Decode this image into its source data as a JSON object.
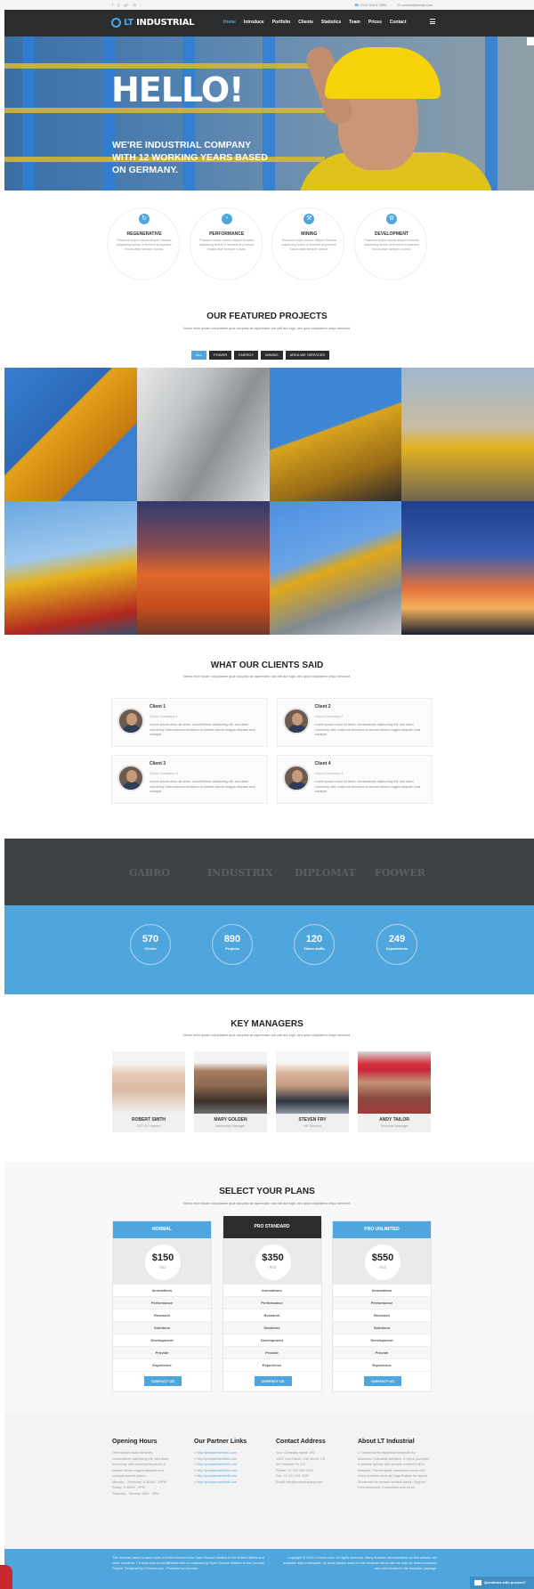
{
  "topbar": {
    "social": [
      "f",
      "y",
      "g+",
      "in"
    ],
    "phone": "+012 345 6 7890",
    "email": "contact@email.com"
  },
  "navbar": {
    "brand_prefix": "LT",
    "brand": "INDUSTRIAL",
    "menu": [
      "Home",
      "Introduce",
      "Portfolio",
      "Clients",
      "Statistics",
      "Team",
      "Prices",
      "Contact"
    ],
    "active_index": 0
  },
  "hero": {
    "title": "HELLO!",
    "subtitle": "WE'RE INDUSTRIAL COMPANY WITH 12 WORKING YEARS BASED ON GERMANY."
  },
  "features": [
    {
      "title": "REGENERATIVE",
      "text": "Praesent turpis mauris aliquet Gravida adipiscing lectus ut ferment at posuere fuscia vitae semper conval.",
      "icon": "refresh-icon"
    },
    {
      "title": "PERFORMANCE",
      "text": "Praesent turpis mauris aliquet Gravida adipiscing lectus ut ferment at posuere fuscia vitae semper conval.",
      "icon": "gauge-icon"
    },
    {
      "title": "MINING",
      "text": "Praesent turpis mauris aliquet Gravida adipiscing lectus ut ferment at posuere fuscia vitae semper conval.",
      "icon": "pickaxe-icon"
    },
    {
      "title": "DEVELOPMENT",
      "text": "Praesent turpis mauris aliquet Gravida adipiscing lectus ut ferment at posuere fuscia vitae semper conval.",
      "icon": "gear-icon"
    }
  ],
  "projects": {
    "title": "OUR FEATURED PROJECTS",
    "subtitle": "Nemo enim ipsam voluptatem quia voluptas sit aspernatur aut odit aut fugit, sed quia voluptatem sequi nesciunt.",
    "filters": [
      "ALL",
      "POWER",
      "ENERGY",
      "MINING",
      "AREA WE SERVICES"
    ],
    "active_filter": 0
  },
  "clients": {
    "title": "WHAT OUR CLIENTS SAID",
    "subtitle": "Nemo enim ipsam voluptatem quia voluptas sit aspernatur aut odit aut fugit, sed quia voluptatem sequi nesciunt.",
    "items": [
      {
        "name": "Client 1",
        "company": "Client Company 1",
        "quote": "Lorem ipsum dolor sit amet, consectetuer adipiscing elit, sed diam nonummy nibh euismod tincidunt ut laoreet dolore magna aliquam erat volutpat."
      },
      {
        "name": "Client 2",
        "company": "Client Company 2",
        "quote": "Lorem ipsum dolor sit amet, consectetuer adipiscing elit, sed diam nonummy nibh euismod tincidunt ut laoreet dolore magna aliquam erat volutpat."
      },
      {
        "name": "Client 3",
        "company": "Client Company 3",
        "quote": "Lorem ipsum dolor sit amet, consectetuer adipiscing elit, sed diam nonummy nibh euismod tincidunt ut laoreet dolore magna aliquam erat volutpat."
      },
      {
        "name": "Client 4",
        "company": "Client Company 4",
        "quote": "Lorem ipsum dolor sit amet, consectetuer adipiscing elit, sed diam nonummy nibh euismod tincidunt ut laoreet dolore magna aliquam erat volutpat."
      }
    ]
  },
  "partners": [
    "GABRO",
    "INDUSTRIX",
    "DIPLOMAT",
    "FOOWER"
  ],
  "stats": [
    {
      "value": "570",
      "label": "Clients"
    },
    {
      "value": "890",
      "label": "Projects"
    },
    {
      "value": "120",
      "label": "Talent staffs"
    },
    {
      "value": "249",
      "label": "Departments"
    }
  ],
  "managers": {
    "title": "KEY MANAGERS",
    "subtitle": "Nemo enim ipsam voluptatem quia voluptas sit aspernatur aut odit aut fugit, sed quia voluptatem sequi nesciunt.",
    "items": [
      {
        "name": "ROBERT SMITH",
        "role": "CEO & Founder"
      },
      {
        "name": "MARY GOLDEN",
        "role": "Marketing Manager"
      },
      {
        "name": "STEVEN FRY",
        "role": "HR Director"
      },
      {
        "name": "ANDY TAILOR",
        "role": "Technical Manager"
      }
    ]
  },
  "plans": {
    "title": "SELECT YOUR PLANS",
    "subtitle": "Nemo enim ipsam voluptatem quia voluptas sit aspernatur aut odit aut fugit, sed quia voluptatem sequi nesciunt.",
    "features": [
      "Innovations",
      "Performance",
      "Research",
      "Solutions",
      "Development",
      "Provide",
      "Experience"
    ],
    "items": [
      {
        "name": "NORMAL",
        "price": "$150",
        "unit": "/m2",
        "button": "CONTACT US"
      },
      {
        "name": "PRO STANDARD",
        "price": "$350",
        "unit": "/m2",
        "button": "CONTACT US"
      },
      {
        "name": "PRO UNLIMITED",
        "price": "$550",
        "unit": "/m2",
        "button": "CONTACT US"
      }
    ]
  },
  "footer": {
    "hours": {
      "title": "Opening Hours",
      "lines": [
        "Orem ipsum dolor sit amet,",
        "consectetuer adipiscing elit, sed diam",
        "nonummy nibh euismod tincidunt ut",
        "laoreet dolore magna aliquam erat",
        "volutpat laoreet dolore.",
        "Monday - Thursday: 8.30AM - 10PM",
        "Friday: 8.30AM - 9PM",
        "Saturday - Sunday: 8AM - 4PM"
      ]
    },
    "links": {
      "title": "Our Partner Links",
      "items": [
        "> http://yourpartnerlink1.com",
        "> http://yourpartnerlink2.com",
        "> http://yourpartnerlink3.com",
        "> http://yourpartnerlink4.com",
        "> http://yourpartnerlink5.com",
        "> http://yourpartnerlink6.com"
      ]
    },
    "contact": {
      "title": "Contact Address",
      "lines": [
        "Your Company Name JSC",
        "1002 Your Street, City World, US",
        "49 Chamber St, CA",
        "Phone: +1 222 334 3434",
        "Fax: +1 221 434 2222",
        "Email: info@yourcompany.com"
      ]
    },
    "about": {
      "title": "About LT Industrial",
      "text": "LT Industrial is responsive template for business / industrial websites. It helps you build a website quickly with sample content built in template. The template framework come with many features such as Page Builder for layout, Shortcode for present content easily, Support Font Awesome, Colorpicker and so on."
    }
  },
  "copyright": {
    "left": "The Joomla! name is used under a limited license from Open Source Matters in the United States and other countries. LTheme.com is not affiliated with or endorsed by Open Source Matters or the Joomla! Project. Designed by LTheme.com - Powered by Joomla!",
    "right": "Copyright © 2016 LTheme.com. All rights reserved. Many features demonstrated on this website are available only in template. All stock photos used on this template demo site are only for demo purposes and not included in the template package."
  },
  "feedback": {
    "label": "Questions with product?"
  }
}
